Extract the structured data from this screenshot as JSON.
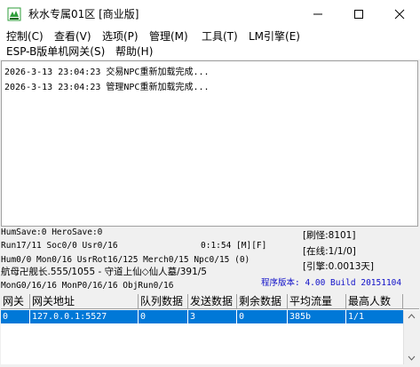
{
  "window": {
    "title": "秋水专属01区 [商业版]"
  },
  "menu": {
    "row1": [
      "控制(C)",
      "查看(V)",
      "选项(P)",
      "管理(M)",
      "工具(T)",
      "LM引擎(E)"
    ],
    "row2": [
      "ESP-B版单机网关(S)",
      "帮助(H)"
    ]
  },
  "log": [
    "2026-3-13 23:04:23 交易NPC重新加载完成...",
    "2026-3-13 23:04:23 管理NPC重新加载完成..."
  ],
  "status": {
    "line1": "HumSave:0 HeroSave:0",
    "line2a": "Run17/11 Soc0/0 Usr0/16",
    "line2b": "0:1:54 [M][F]",
    "line3": "Hum0/0 Mon0/16 UsrRot16/125 Merch0/15 Npc0/15 (0)",
    "line4": "航母卍舰长.555/1055 - 守道上仙◇仙人墓/391/5",
    "line5": "MonG0/16/16 MonP0/16/16 ObjRun0/16",
    "refresh": "[刷怪:8101]",
    "online": "[在线:1/1/0]",
    "engine": "[引擎:0.0013天]",
    "version": "程序版本: 4.00 Build 20151104"
  },
  "table": {
    "headers": [
      "网关",
      "网关地址",
      "队列数据",
      "发送数据",
      "剩余数据",
      "平均流量",
      "最高人数"
    ],
    "rows": [
      [
        "0",
        "127.0.0.1:5527",
        "0",
        "3",
        "0",
        "385b",
        "1/1"
      ]
    ]
  },
  "colors": {
    "selection": "#0078d7",
    "version_text": "#1010c8",
    "icon_green": "#2e9e3a"
  }
}
